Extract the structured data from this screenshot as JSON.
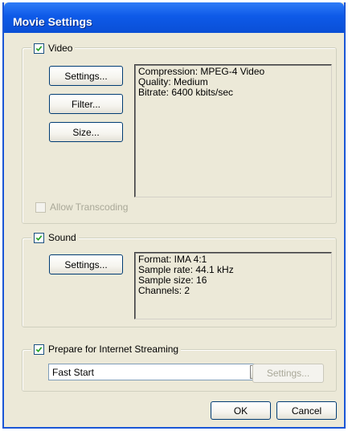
{
  "window": {
    "title": "Movie Settings"
  },
  "video": {
    "checkbox_label": "Video",
    "checked": true,
    "buttons": {
      "settings": "Settings...",
      "filter": "Filter...",
      "size": "Size..."
    },
    "info_lines": [
      "Compression: MPEG-4 Video",
      "Quality: Medium",
      "Bitrate: 6400 kbits/sec"
    ],
    "allow_transcoding_label": "Allow Transcoding",
    "allow_transcoding_checked": false,
    "allow_transcoding_enabled": false
  },
  "sound": {
    "checkbox_label": "Sound",
    "checked": true,
    "buttons": {
      "settings": "Settings..."
    },
    "info_lines": [
      "Format: IMA 4:1",
      "Sample rate: 44.1 kHz",
      "Sample size: 16",
      "Channels: 2"
    ]
  },
  "streaming": {
    "checkbox_label": "Prepare for Internet Streaming",
    "checked": true,
    "dropdown_value": "Fast Start",
    "settings_button": "Settings...",
    "settings_enabled": false
  },
  "footer": {
    "ok_label": "OK",
    "cancel_label": "Cancel"
  },
  "colors": {
    "title_bar": "#0a4fd6",
    "dialog_bg": "#ece9d8",
    "button_border": "#003c74"
  },
  "icons": {
    "checkmark": "checkmark-icon",
    "dropdown": "dropdown-arrow-icon"
  }
}
